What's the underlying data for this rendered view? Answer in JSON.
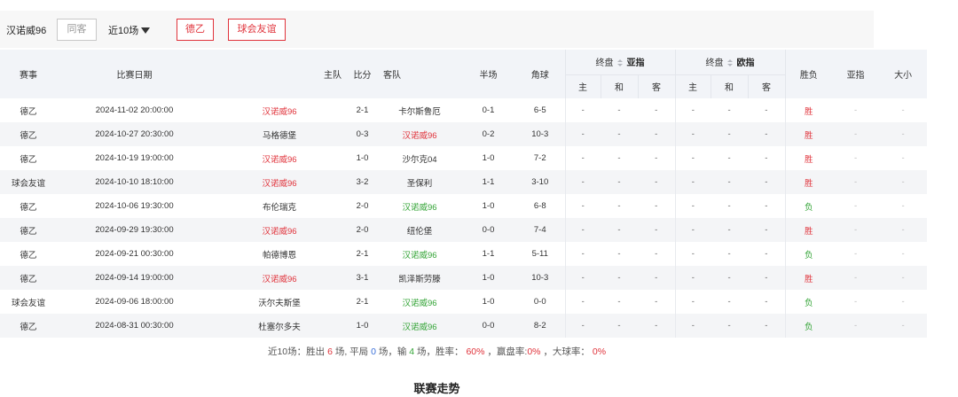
{
  "filter": {
    "team": "汉诺威96",
    "home_away_label": "同客",
    "recent_label": "近10场",
    "league_label": "德乙",
    "friendly_label": "球会友谊"
  },
  "header": {
    "competition": "赛事",
    "date": "比赛日期",
    "home": "主队",
    "score": "比分",
    "away": "客队",
    "half": "半场",
    "corners": "角球",
    "final_asian": "终盘",
    "asian_title": "亚指",
    "final_euro": "终盘",
    "euro_title": "欧指",
    "sub_home": "主",
    "sub_draw": "和",
    "sub_away": "客",
    "result": "胜负",
    "asian_col": "亚指",
    "over_under": "大小"
  },
  "rows": [
    {
      "comp": "德乙",
      "date": "2024-11-02 20:00:00",
      "home": "汉诺威96",
      "score": "2-1",
      "away": "卡尔斯鲁厄",
      "half": "0-1",
      "corners": "6-5",
      "result": "胜",
      "hl": "home",
      "hl_color": "red",
      "res_type": "win"
    },
    {
      "comp": "德乙",
      "date": "2024-10-27 20:30:00",
      "home": "马格德堡",
      "score": "0-3",
      "away": "汉诺威96",
      "half": "0-2",
      "corners": "10-3",
      "result": "胜",
      "hl": "away",
      "hl_color": "red",
      "res_type": "win"
    },
    {
      "comp": "德乙",
      "date": "2024-10-19 19:00:00",
      "home": "汉诺威96",
      "score": "1-0",
      "away": "沙尔克04",
      "half": "1-0",
      "corners": "7-2",
      "result": "胜",
      "hl": "home",
      "hl_color": "red",
      "res_type": "win"
    },
    {
      "comp": "球会友谊",
      "date": "2024-10-10 18:10:00",
      "home": "汉诺威96",
      "score": "3-2",
      "away": "圣保利",
      "half": "1-1",
      "corners": "3-10",
      "result": "胜",
      "hl": "home",
      "hl_color": "red",
      "res_type": "win"
    },
    {
      "comp": "德乙",
      "date": "2024-10-06 19:30:00",
      "home": "布伦瑞克",
      "score": "2-0",
      "away": "汉诺威96",
      "half": "1-0",
      "corners": "6-8",
      "result": "负",
      "hl": "away",
      "hl_color": "green",
      "res_type": "loss"
    },
    {
      "comp": "德乙",
      "date": "2024-09-29 19:30:00",
      "home": "汉诺威96",
      "score": "2-0",
      "away": "纽伦堡",
      "half": "0-0",
      "corners": "7-4",
      "result": "胜",
      "hl": "home",
      "hl_color": "red",
      "res_type": "win"
    },
    {
      "comp": "德乙",
      "date": "2024-09-21 00:30:00",
      "home": "帕德博恩",
      "score": "2-1",
      "away": "汉诺威96",
      "half": "1-1",
      "corners": "5-11",
      "result": "负",
      "hl": "away",
      "hl_color": "green",
      "res_type": "loss"
    },
    {
      "comp": "德乙",
      "date": "2024-09-14 19:00:00",
      "home": "汉诺威96",
      "score": "3-1",
      "away": "凯泽斯劳滕",
      "half": "1-0",
      "corners": "10-3",
      "result": "胜",
      "hl": "home",
      "hl_color": "red",
      "res_type": "win"
    },
    {
      "comp": "球会友谊",
      "date": "2024-09-06 18:00:00",
      "home": "沃尔夫斯堡",
      "score": "2-1",
      "away": "汉诺威96",
      "half": "1-0",
      "corners": "0-0",
      "result": "负",
      "hl": "away",
      "hl_color": "green",
      "res_type": "loss"
    },
    {
      "comp": "德乙",
      "date": "2024-08-31 00:30:00",
      "home": "杜塞尔多夫",
      "score": "1-0",
      "away": "汉诺威96",
      "half": "0-0",
      "corners": "8-2",
      "result": "负",
      "hl": "away",
      "hl_color": "green",
      "res_type": "loss"
    }
  ],
  "placeholder": "-",
  "summary": {
    "prefix": "近10场：胜出",
    "wins": "6",
    "mid1": "场, 平局",
    "draws": "0",
    "mid2": "场，输",
    "losses": "4",
    "mid3": "场，胜率：",
    "win_rate": "60%",
    "mid4": "，赢盘率:",
    "cover_rate": "0%",
    "mid5": "，大球率：",
    "over_rate": "0%"
  },
  "section_title": "联赛走势",
  "colors": {
    "accent_red": "#e0333b",
    "accent_green": "#33a436",
    "accent_blue": "#3a6fd8",
    "header_bg": "#f2f4f8"
  }
}
